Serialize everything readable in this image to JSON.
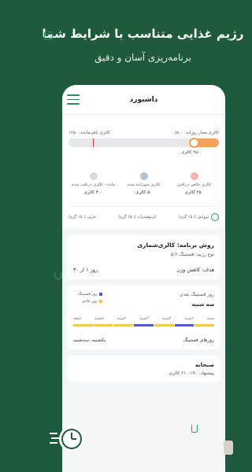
{
  "hero": {
    "title": "رژیم غذایی متناسب با شرایط شما",
    "subtitle": "برنامه‌ریزی آسان و دقیق"
  },
  "topbar": {
    "title": "داشبورد"
  },
  "calories": {
    "allowed_label": "کالری مجاز روزانه: ۱۵۰۰",
    "remaining_label": "کالری باقی‌مانده: ۱۲۵۰",
    "consumed_label": "۲۵۰ کالری",
    "progress_fraction": 0.167
  },
  "stats": [
    {
      "label": "کالری خالص دریافتی",
      "value": "۲۵۰ کالری"
    },
    {
      "label": "کالری سوزانده شده",
      "value": "۵۰ کالری"
    },
    {
      "label": "مانده - کالری دریافت شده",
      "value": "۳۰۰ کالری"
    }
  ],
  "macros": [
    {
      "label": "پروتئین (۱۵۰ گرم)"
    },
    {
      "label": "کربوهیدرات (۱۵۰ گرم)"
    },
    {
      "label": "چربی (۱۵۰ گرم)"
    }
  ],
  "program": {
    "title": "روش برنامه: کالری‌شماری",
    "type": "نوع رژیم: فستینگ ۵:۲",
    "goal": "هدف: کاهش وزن",
    "day": "روز ۱ از ۳۰"
  },
  "fasting": {
    "title": "روز فستینگ بعدی",
    "next_day": "سه شنبه",
    "legend": [
      {
        "label": "روز فستینگ",
        "color": "#4f5ac7"
      },
      {
        "label": "روز عادی",
        "color": "#f3c94a"
      }
    ],
    "days": [
      "شنبه",
      "۱شنبه",
      "۲شنبه",
      "۳شنبه",
      "۴شنبه",
      "۵شنبه",
      "جمعه"
    ],
    "day_colors": [
      "#f3c94a",
      "#4f5ac7",
      "#f3c94a",
      "#4f5ac7",
      "#f3c94a",
      "#f3c94a",
      "#f3c94a"
    ],
    "days_label": "روزهای فستینگ",
    "days_value": "یکشنبه، سه‌شنبه"
  },
  "meal": {
    "title": "صبحانه",
    "suggestion": "پیشنهاد: ۱۹۰-۲۱۰ کالری"
  },
  "colors": {
    "brand": "#1f5a3c",
    "accent": "#2a8a63",
    "progress": "#f4a259"
  }
}
